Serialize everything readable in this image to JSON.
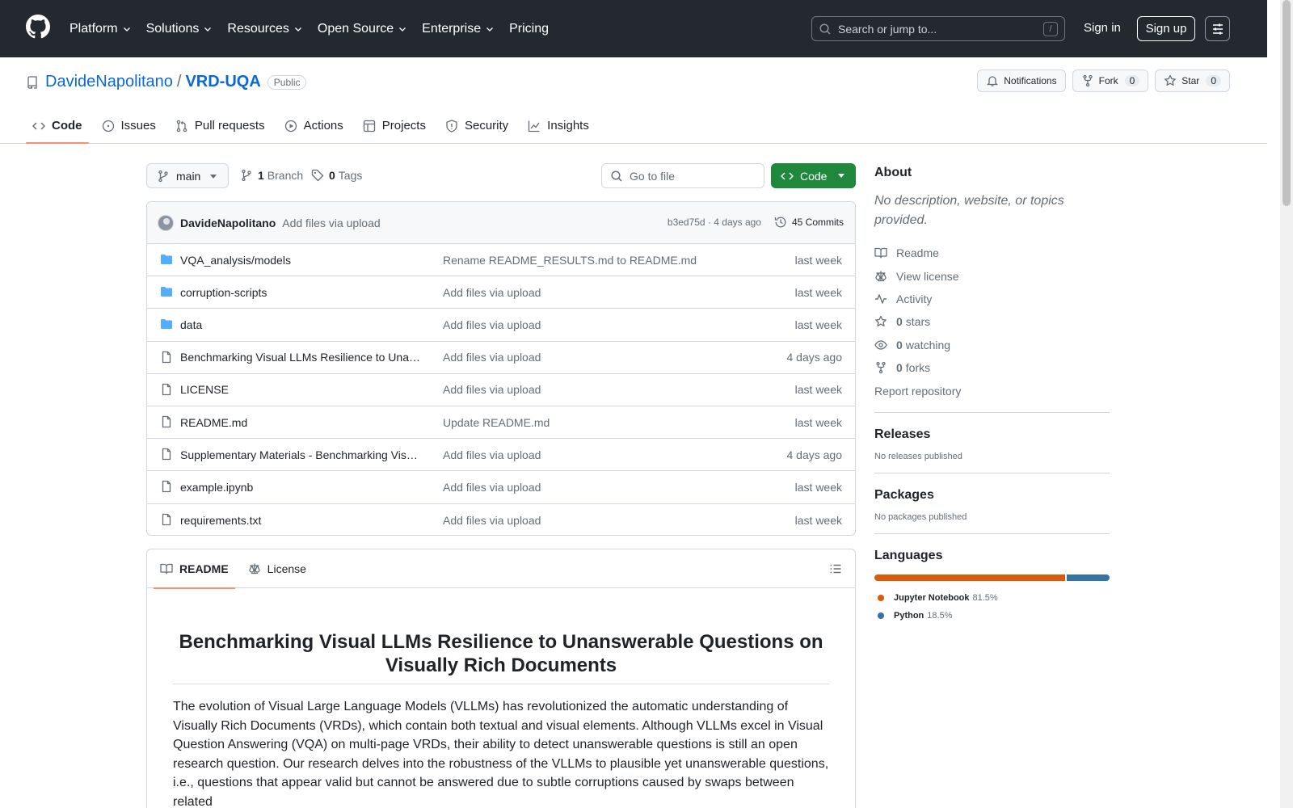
{
  "nav": {
    "items": [
      "Platform",
      "Solutions",
      "Resources",
      "Open Source",
      "Enterprise",
      "Pricing"
    ],
    "search_placeholder": "Search or jump to...",
    "search_shortcut": "/",
    "signin": "Sign in",
    "signup": "Sign up"
  },
  "repo": {
    "owner": "DavideNapolitano",
    "separator": "/",
    "name": "VRD-UQA",
    "visibility": "Public",
    "notifications": "Notifications",
    "fork_label": "Fork",
    "fork_count": "0",
    "star_label": "Star",
    "star_count": "0"
  },
  "tabs": [
    "Code",
    "Issues",
    "Pull requests",
    "Actions",
    "Projects",
    "Security",
    "Insights"
  ],
  "toolbar": {
    "branch": "main",
    "branch_count": "1",
    "branch_label": "Branch",
    "tag_count": "0",
    "tag_label": "Tags",
    "goto_placeholder": "Go to file",
    "code_button": "Code"
  },
  "commit": {
    "author": "DavideNapolitano",
    "message": "Add files via upload",
    "hash_time": "b3ed75d · 4 days ago",
    "commits": "45 Commits"
  },
  "files": [
    {
      "type": "dir",
      "name": "VQA_analysis/models",
      "message": "Rename README_RESULTS.md to README.md",
      "date": "last week"
    },
    {
      "type": "dir",
      "name": "corruption-scripts",
      "message": "Add files via upload",
      "date": "last week"
    },
    {
      "type": "dir",
      "name": "data",
      "message": "Add files via upload",
      "date": "last week"
    },
    {
      "type": "file",
      "name": "Benchmarking Visual LLMs Resilience to Unanswerable Questions on Visually Rich Documents.pdf",
      "message": "Add files via upload",
      "date": "4 days ago"
    },
    {
      "type": "file",
      "name": "LICENSE",
      "message": "Add files via upload",
      "date": "last week"
    },
    {
      "type": "file",
      "name": "README.md",
      "message": "Update README.md",
      "date": "last week"
    },
    {
      "type": "file",
      "name": "Supplementary Materials - Benchmarking Visual LLMs Resilience.pdf",
      "message": "Add files via upload",
      "date": "4 days ago"
    },
    {
      "type": "file",
      "name": "example.ipynb",
      "message": "Add files via upload",
      "date": "last week"
    },
    {
      "type": "file",
      "name": "requirements.txt",
      "message": "Add files via upload",
      "date": "last week"
    }
  ],
  "readme": {
    "tab_readme": "README",
    "tab_license": "License",
    "title": "Benchmarking Visual LLMs Resilience to Unanswerable Questions on Visually Rich Documents",
    "body": "The evolution of Visual Large Language Models (VLLMs) has revolutionized the automatic understanding of Visually Rich Documents (VRDs), which contain both textual and visual elements. Although VLLMs excel in Visual Question Answering (VQA) on multi-page VRDs, their ability to detect unanswerable questions is still an open research question. Our research delves into the robustness of the VLLMs to plausible yet unanswerable questions, i.e., questions that appear valid but cannot be answered due to subtle corruptions caused by swaps between related"
  },
  "about": {
    "title": "About",
    "description": "No description, website, or topics provided.",
    "readme": "Readme",
    "license": "View license",
    "activity": "Activity",
    "stars_count": "0",
    "stars_label": "stars",
    "watching_count": "0",
    "watching_label": "watching",
    "forks_count": "0",
    "forks_label": "forks",
    "report": "Report repository"
  },
  "releases": {
    "title": "Releases",
    "note": "No releases published"
  },
  "packages": {
    "title": "Packages",
    "note": "No packages published"
  },
  "languages": {
    "title": "Languages",
    "items": [
      {
        "name": "Jupyter Notebook",
        "percent": "81.5%",
        "value": 81.5,
        "color": "#DA5B0B"
      },
      {
        "name": "Python",
        "percent": "18.5%",
        "value": 18.5,
        "color": "#3572A5"
      }
    ]
  }
}
